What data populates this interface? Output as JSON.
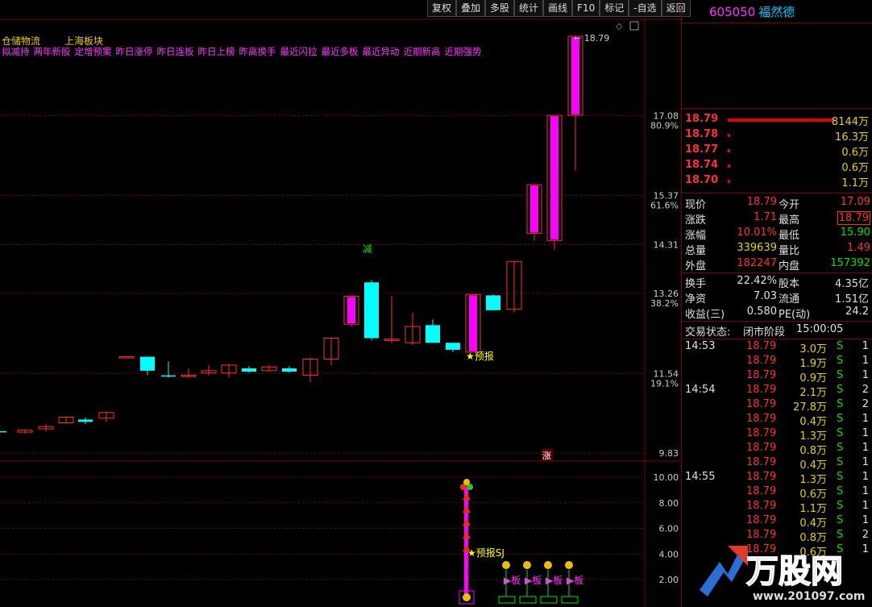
{
  "toolbar": [
    "复权",
    "叠加",
    "多股",
    "统计",
    "画线",
    "F10",
    "标记",
    "-自选",
    "返回"
  ],
  "stock": {
    "code": "605050",
    "name": "福然德"
  },
  "tags": {
    "line1_a": "仓储物流",
    "line1_b": "上海板块",
    "line2": [
      "拟减持",
      "两年新股",
      "定增预案",
      "昨日涨停",
      "昨日连板",
      "昨日上榜",
      "昨高换手",
      "最近闪拉",
      "最近多板",
      "最近异动",
      "近期新高",
      "近期强势"
    ]
  },
  "price_axis": [
    {
      "label": "17.08",
      "pct": "80.9%"
    },
    {
      "label": "15.37",
      "pct": "61.6%"
    },
    {
      "label": "14.31",
      "pct": ""
    },
    {
      "label": "13.26",
      "pct": "38.2%"
    },
    {
      "label": "11.54",
      "pct": "19.1%"
    },
    {
      "label": "9.83",
      "pct": ""
    }
  ],
  "indicator_axis": [
    "10.00",
    "8.00",
    "6.00",
    "4.00",
    "2.00"
  ],
  "annotations": {
    "high": "18.79",
    "reduce": "减",
    "forecast": "★预报",
    "forecast2": "★预报SJ",
    "zhang": "涨",
    "ban": "▶板"
  },
  "orderbook": [
    {
      "price": "18.79",
      "vol": "8144万",
      "bar": 1.0
    },
    {
      "price": "18.78",
      "vol": "16.3万",
      "bar": 0.01
    },
    {
      "price": "18.77",
      "vol": "0.6万",
      "bar": 0.01
    },
    {
      "price": "18.74",
      "vol": "0.6万",
      "bar": 0.01
    },
    {
      "price": "18.70",
      "vol": "1.1万",
      "bar": 0.01
    }
  ],
  "quote": [
    {
      "l1": "现价",
      "v1": "18.79",
      "c1": "red",
      "l2": "今开",
      "v2": "17.09",
      "c2": "red"
    },
    {
      "l1": "涨跌",
      "v1": "1.71",
      "c1": "red",
      "l2": "最高",
      "v2": "18.79",
      "c2": "red"
    },
    {
      "l1": "涨幅",
      "v1": "10.01%",
      "c1": "red",
      "l2": "最低",
      "v2": "15.90",
      "c2": "grn"
    },
    {
      "l1": "总量",
      "v1": "339639",
      "c1": "yel",
      "l2": "量比",
      "v2": "1.49",
      "c2": "red"
    },
    {
      "l1": "外盘",
      "v1": "182247",
      "c1": "red",
      "l2": "内盘",
      "v2": "157392",
      "c2": "grn"
    }
  ],
  "fundamentals": [
    {
      "l1": "换手",
      "v1": "22.42%",
      "l2": "股本",
      "v2": "4.35亿"
    },
    {
      "l1": "净资",
      "v1": "7.03",
      "l2": "流通",
      "v2": "1.51亿"
    },
    {
      "l1": "收益(三)",
      "v1": "0.580",
      "l2": "PE(动)",
      "v2": "24.2"
    }
  ],
  "status": {
    "label": "交易状态:",
    "value": "闭市阶段",
    "time": "15:00:05"
  },
  "deals": [
    {
      "time": "14:53",
      "price": "18.79",
      "vol": "3.0万",
      "side": "S",
      "n": "1"
    },
    {
      "time": "",
      "price": "18.79",
      "vol": "1.9万",
      "side": "S",
      "n": "1"
    },
    {
      "time": "",
      "price": "18.79",
      "vol": "0.9万",
      "side": "S",
      "n": "1"
    },
    {
      "time": "14:54",
      "price": "18.79",
      "vol": "2.1万",
      "side": "S",
      "n": "2"
    },
    {
      "time": "",
      "price": "18.79",
      "vol": "27.8万",
      "side": "S",
      "n": "2"
    },
    {
      "time": "",
      "price": "18.79",
      "vol": "0.4万",
      "side": "S",
      "n": "1"
    },
    {
      "time": "",
      "price": "18.79",
      "vol": "1.3万",
      "side": "S",
      "n": "1"
    },
    {
      "time": "",
      "price": "18.79",
      "vol": "0.8万",
      "side": "S",
      "n": "1"
    },
    {
      "time": "",
      "price": "18.79",
      "vol": "0.4万",
      "side": "S",
      "n": "1"
    },
    {
      "time": "14:55",
      "price": "18.79",
      "vol": "1.3万",
      "side": "S",
      "n": "1"
    },
    {
      "time": "",
      "price": "18.79",
      "vol": "0.6万",
      "side": "S",
      "n": "1"
    },
    {
      "time": "",
      "price": "18.79",
      "vol": "1.1万",
      "side": "S",
      "n": "1"
    },
    {
      "time": "",
      "price": "18.79",
      "vol": "0.4万",
      "side": "S",
      "n": "1"
    },
    {
      "time": "",
      "price": "18.79",
      "vol": "0.8万",
      "side": "S",
      "n": "2"
    },
    {
      "time": "",
      "price": "18.79",
      "vol": "0.6万",
      "side": "S",
      "n": "1"
    }
  ],
  "watermark": {
    "brand": "万股网",
    "url": "www.201097.com"
  },
  "colors": {
    "up": "#ff3030",
    "magenta": "#ff00ff",
    "down": "#00ffff",
    "grid": "#7b0000"
  }
}
